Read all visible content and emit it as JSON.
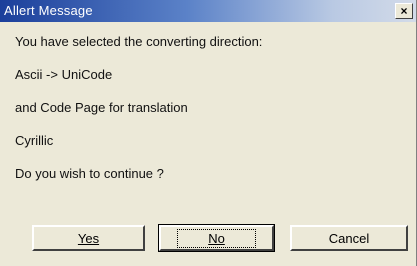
{
  "window": {
    "title": "Allert Message",
    "close_label": "×",
    "close_icon": "close-icon"
  },
  "message": {
    "line1": "You have selected the converting direction:",
    "line2": "Ascii -> UniCode",
    "line3": "and Code Page for translation",
    "line4": "Cyrillic",
    "line5": "Do you wish to continue ?"
  },
  "buttons": {
    "yes_label": "Yes",
    "no_label": "No",
    "cancel_label": "Cancel"
  },
  "colors": {
    "titlebar_start": "#1b3f9b",
    "titlebar_end": "#d3dbe9",
    "dialog_bg": "#ece9d8"
  }
}
